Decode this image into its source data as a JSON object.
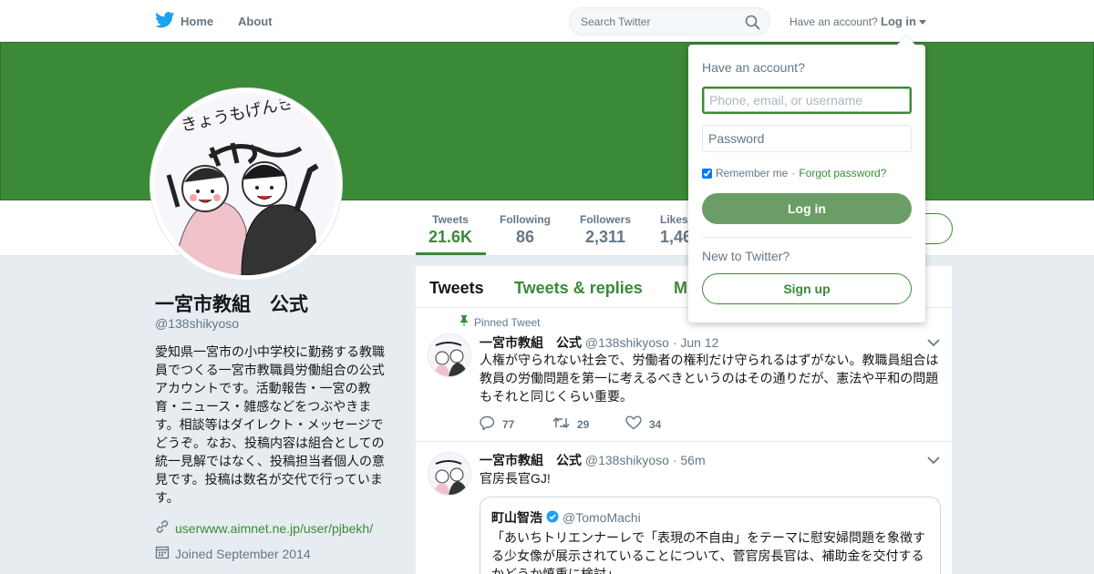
{
  "colors": {
    "accent": "#3b8a37",
    "banner": "#3b8a37",
    "muted": "#657786",
    "background": "#e6ecf0"
  },
  "nav": {
    "home_label": "Home",
    "about_label": "About",
    "search_placeholder": "Search Twitter",
    "have_account": "Have an account?",
    "login_label": "Log in"
  },
  "stats": [
    {
      "label": "Tweets",
      "value": "21.6K"
    },
    {
      "label": "Following",
      "value": "86"
    },
    {
      "label": "Followers",
      "value": "2,311"
    },
    {
      "label": "Likes",
      "value": "1,46"
    }
  ],
  "profile": {
    "name": "一宮市教組　公式",
    "handle": "@138shikyoso",
    "bio": "愛知県一宮市の小中学校に勤務する教職員でつくる一宮市教職員労働組合の公式アカウントです。活動報告・一宮の教育・ニュース・雑感などをつぶやきます。相談等はダイレクト・メッセージでどうぞ。なお、投稿内容は組合としての統一見解ではなく、投稿担当者個人の意見です。投稿は数名が交代で行っています。",
    "url": "userwww.aimnet.ne.jp/user/pjbekh/",
    "joined": "Joined September 2014"
  },
  "timeline": {
    "tabs": [
      "Tweets",
      "Tweets & replies",
      "M"
    ],
    "tweets": [
      {
        "pinned_label": "Pinned Tweet",
        "name": "一宮市教組　公式",
        "handle": "@138shikyoso",
        "time": "· Jun 12",
        "text": "人権が守られない社会で、労働者の権利だけ守られるはずがない。教職員組合は教員の労働問題を第一に考えるべきというのはその通りだが、憲法や平和の問題もそれと同じくらい重要。",
        "replies": "77",
        "retweets": "29",
        "likes": "34"
      },
      {
        "name": "一宮市教組　公式",
        "handle": "@138shikyoso",
        "time": "· 56m",
        "text": "官房長官GJ!",
        "quote": {
          "name": "町山智浩",
          "handle": "@TomoMachi",
          "text": "「あいちトリエンナーレで「表現の不自由」をテーマに慰安婦問題を象徴する少女像が展示されていることについて、菅官房長官は、補助金を交付するかどうか慎重に検討」"
        }
      }
    ]
  },
  "login_dropdown": {
    "title": "Have an account?",
    "username_placeholder": "Phone, email, or username",
    "password_placeholder": "Password",
    "remember_label": "Remember me",
    "separator": "·",
    "forgot_label": "Forgot password?",
    "login_button": "Log in",
    "new_label": "New to Twitter?",
    "signup_button": "Sign up"
  },
  "avatar_art": {
    "caption": "きょうもげんきに"
  }
}
